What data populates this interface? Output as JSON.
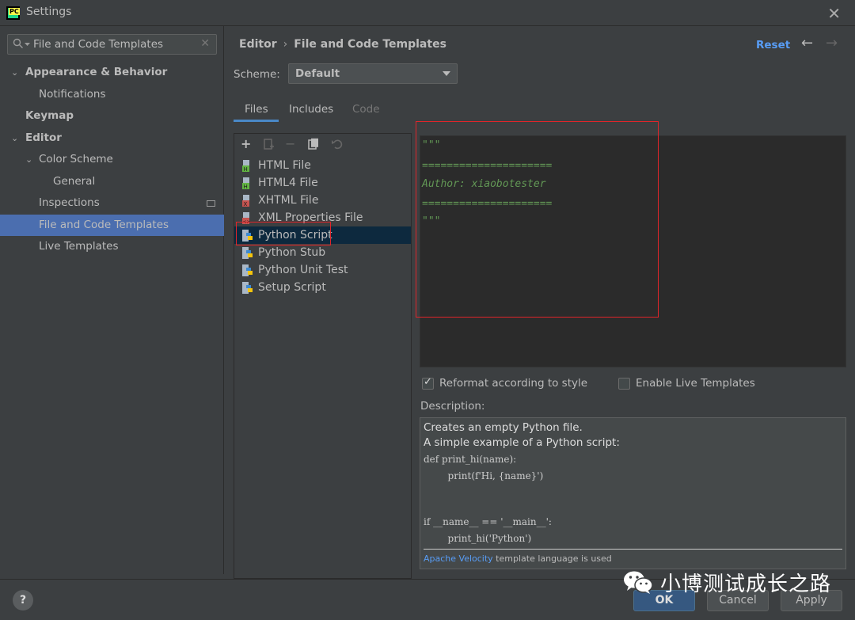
{
  "window": {
    "title": "Settings"
  },
  "search": {
    "value": "File and Code Templates"
  },
  "tree": [
    {
      "label": "Appearance & Behavior",
      "expanded": true
    },
    {
      "label": "Notifications"
    },
    {
      "label": "Keymap"
    },
    {
      "label": "Editor",
      "expanded": true
    },
    {
      "label": "Color Scheme",
      "expanded": true
    },
    {
      "label": "General"
    },
    {
      "label": "Inspections"
    },
    {
      "label": "File and Code Templates",
      "selected": true
    },
    {
      "label": "Live Templates"
    }
  ],
  "breadcrumb": {
    "parent": "Editor",
    "separator": "›",
    "current": "File and Code Templates"
  },
  "header": {
    "reset_label": "Reset",
    "back_icon": "arrow-left-icon",
    "forward_icon": "arrow-right-icon"
  },
  "scheme": {
    "label": "Scheme:",
    "value": "Default"
  },
  "tabs": [
    {
      "label": "Files",
      "active": true
    },
    {
      "label": "Includes"
    },
    {
      "label": "Code",
      "disabled": true
    }
  ],
  "toolbar": {
    "add": "+",
    "remove": "−"
  },
  "files": [
    {
      "name": "HTML File",
      "icon": "html-file-icon"
    },
    {
      "name": "HTML4 File",
      "icon": "html-file-icon"
    },
    {
      "name": "XHTML File",
      "icon": "xhtml-file-icon"
    },
    {
      "name": "XML Properties File",
      "icon": "xml-file-icon"
    },
    {
      "name": "Python Script",
      "icon": "python-file-icon",
      "selected": true
    },
    {
      "name": "Python Stub",
      "icon": "python-file-icon"
    },
    {
      "name": "Python Unit Test",
      "icon": "python-file-icon"
    },
    {
      "name": "Setup Script",
      "icon": "python-file-icon"
    }
  ],
  "editor": {
    "lines": [
      "\"\"\"",
      "=====================",
      "Author: xiaobotester",
      "=====================",
      "\"\"\""
    ]
  },
  "options": {
    "reformat_label": "Reformat according to style",
    "reformat_checked": true,
    "live_templates_label": "Enable Live Templates",
    "live_templates_checked": false
  },
  "description": {
    "label": "Description:",
    "line1": "Creates an empty Python file.",
    "line2": "A simple example of a Python script:",
    "code1": "def print_hi(name):",
    "code2": "        print(f'Hi, {name}')",
    "code3": "if __name__ == '__main__':",
    "code4": "        print_hi('Python')",
    "footer_link": "Apache Velocity",
    "footer_text": " template language is used"
  },
  "buttons": {
    "help": "?",
    "ok": "OK",
    "cancel": "Cancel",
    "apply": "Apply"
  },
  "watermark": {
    "text": "小博测试成长之路"
  }
}
